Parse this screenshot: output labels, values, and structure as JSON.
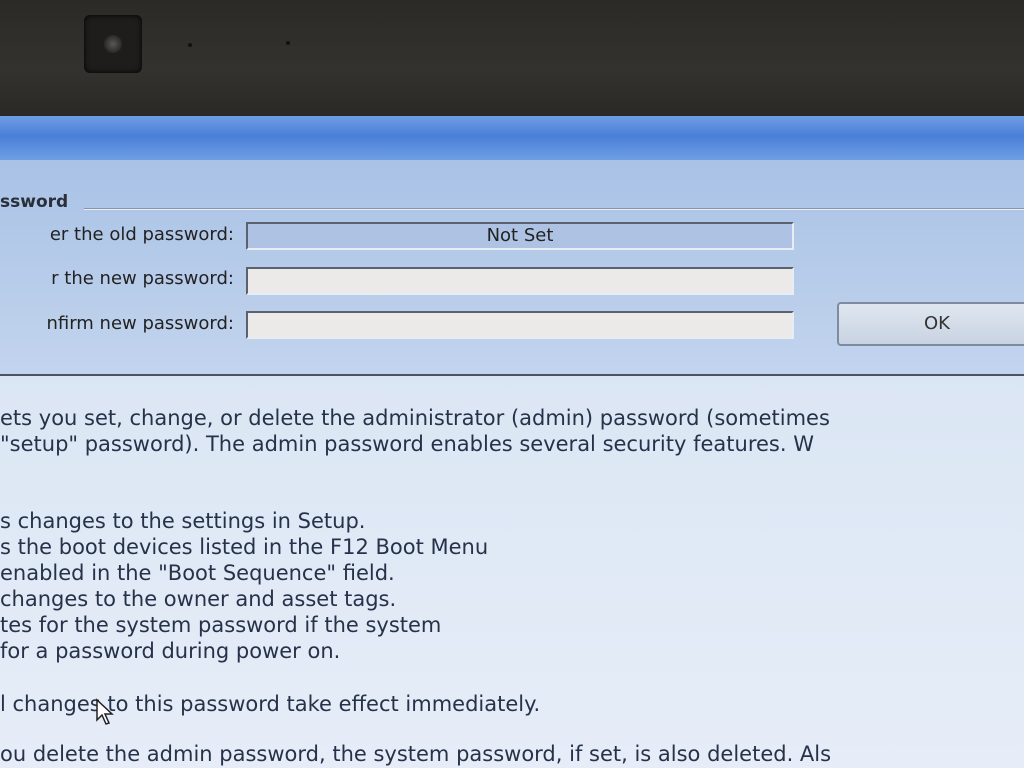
{
  "window": {
    "group_title": "ssword"
  },
  "form": {
    "old_label": "er the old password:",
    "old_value": "Not Set",
    "new_label": "r the new password:",
    "new_value": "",
    "confirm_label": "nfirm new password:",
    "confirm_value": "",
    "ok_label": "OK"
  },
  "help": {
    "intro_1": "ets you set, change, or delete the administrator (admin) password (sometimes",
    "intro_2": "\"setup\" password).  The admin password enables several security features. W",
    "bullets": [
      "s changes to the settings in Setup.",
      "s the boot devices listed in the F12 Boot Menu",
      "enabled in the \"Boot Sequence\" field.",
      "changes to the owner and asset tags.",
      "tes for the system password if the system",
      "for a password during power on."
    ],
    "note_1": "l changes to this password take effect immediately.",
    "note_2": "ou delete the admin password, the system password, if set, is also deleted. Als"
  },
  "colors": {
    "titlebar": "#4a7fd8",
    "panel": "#b8cdea",
    "text": "#263249"
  }
}
